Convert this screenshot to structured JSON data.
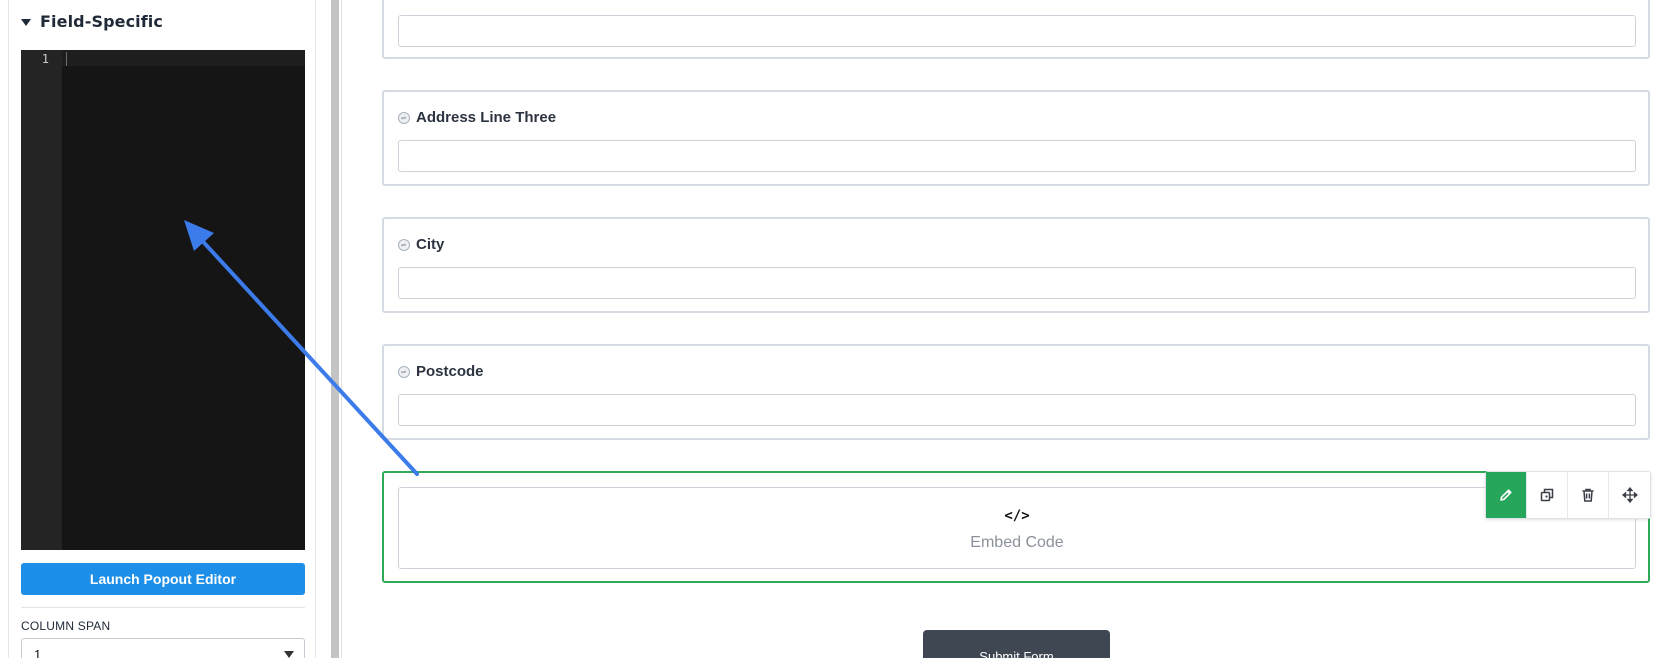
{
  "left_panel": {
    "section_title": "Field-Specific",
    "code_editor": {
      "line_numbers": [
        "1"
      ]
    },
    "launch_button_label": "Launch Popout Editor",
    "column_span": {
      "label": "COLUMN SPAN",
      "value": "1"
    }
  },
  "form": {
    "fields": [
      {
        "label": "",
        "value": ""
      },
      {
        "label": "Address Line Three",
        "value": ""
      },
      {
        "label": "City",
        "value": ""
      },
      {
        "label": "Postcode",
        "value": ""
      }
    ],
    "embed": {
      "icon_glyph": "</>",
      "label": "Embed Code"
    },
    "toolbar": {
      "icons": [
        "pencil-icon",
        "duplicate-icon",
        "trash-icon",
        "move-icon"
      ]
    },
    "submit_label": "Submit Form"
  },
  "colors": {
    "accent_blue": "#1e8fe8",
    "selected_green": "#2eaa58",
    "edit_green": "#26a65b",
    "submit_dark": "#3f4852",
    "annotation_arrow": "#3b7bea"
  }
}
